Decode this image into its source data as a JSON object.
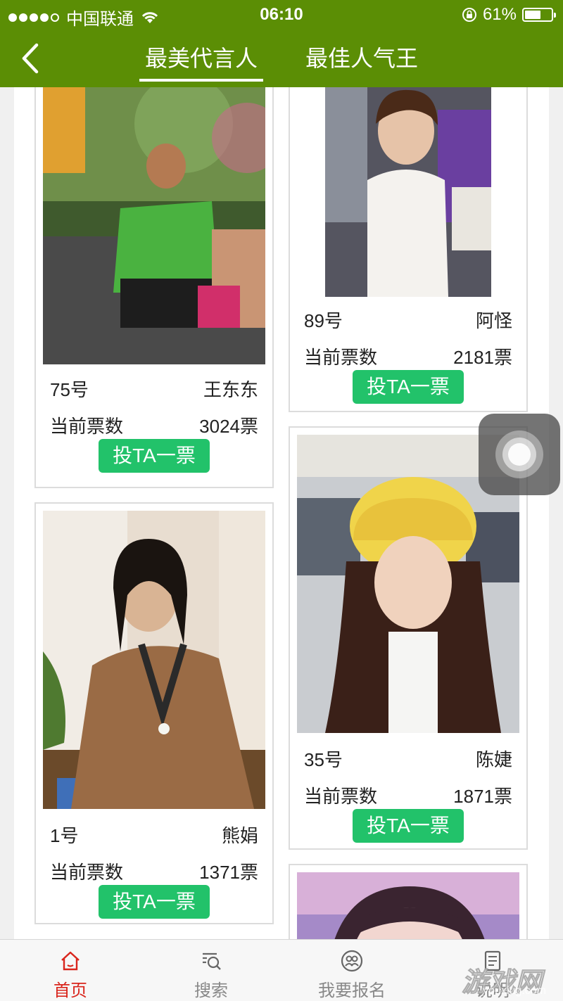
{
  "status_bar": {
    "carrier": "中国联通",
    "time": "06:10",
    "battery_percent": "61%",
    "battery_level": 0.61
  },
  "nav": {
    "tabs": [
      {
        "label": "最美代言人",
        "active": true
      },
      {
        "label": "最佳人气王",
        "active": false
      }
    ]
  },
  "cards": [
    {
      "number": "75号",
      "name": "王东东",
      "votes_label": "当前票数",
      "votes": "3024票",
      "vote_button": "投TA一票"
    },
    {
      "number": "89号",
      "name": "阿怪",
      "votes_label": "当前票数",
      "votes": "2181票",
      "vote_button": "投TA一票"
    },
    {
      "number": "1号",
      "name": "熊娟",
      "votes_label": "当前票数",
      "votes": "1371票",
      "vote_button": "投TA一票"
    },
    {
      "number": "35号",
      "name": "陈婕",
      "votes_label": "当前票数",
      "votes": "1871票",
      "vote_button": "投TA一票"
    }
  ],
  "tabbar": {
    "items": [
      {
        "label": "首页",
        "icon": "home-icon",
        "active": true
      },
      {
        "label": "搜索",
        "icon": "search-icon",
        "active": false
      },
      {
        "label": "我要报名",
        "icon": "people-icon",
        "active": false
      },
      {
        "label": "说明",
        "icon": "document-icon",
        "active": false
      }
    ]
  },
  "watermark": {
    "text": "游戏网",
    "subtext": "youxiug.com"
  },
  "colors": {
    "header_green": "#5b8e05",
    "vote_green": "#22c26a",
    "active_red": "#d9251c"
  }
}
